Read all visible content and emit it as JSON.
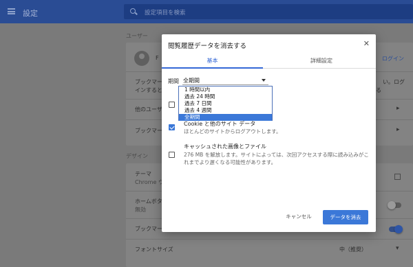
{
  "header": {
    "title": "設定",
    "search_placeholder": "設定項目を検索"
  },
  "background": {
    "section_user": "ユーザー",
    "user_name_partial": "F",
    "signin_link": "ログイン",
    "bookmark_row_a": "ブックマー",
    "sync_text_right": "い。ログ",
    "sync_text_line2": "インすると",
    "sync_text_line2_right": "る",
    "other_people": "他のユーザ",
    "bookmark_row_b": "ブックマー",
    "section_design": "デザイン",
    "theme_label": "テーマ",
    "theme_value": "Chrome ウ",
    "home_label": "ホームボタ",
    "home_value": "無効",
    "bookmark_bar": "ブックマー",
    "font_size_label": "フォントサイズ",
    "font_size_value": "中（推奨）",
    "colors": {
      "header": "#2a4c94",
      "page_dimmed": "#7a7a7a",
      "card_dimmed": "#838383"
    }
  },
  "dialog": {
    "title": "閲覧履歴データを消去する",
    "close_icon": "close-icon",
    "tabs": [
      {
        "label": "基本"
      },
      {
        "label": "詳細設定"
      }
    ],
    "time_range": {
      "label": "期間",
      "value": "全期間",
      "options": [
        {
          "label": "1 時間以内"
        },
        {
          "label": "過去 24 時間"
        },
        {
          "label": "過去 7 日間"
        },
        {
          "label": "過去 4 週間"
        },
        {
          "label": "全期間"
        }
      ]
    },
    "items": [
      {
        "title": "",
        "description": "リート データを削除します。",
        "checked": false
      },
      {
        "title": "Cookie と他のサイト データ",
        "description": "ほとんどのサイトからログアウトします。",
        "checked": true
      },
      {
        "title": "キャッシュされた画像とファイル",
        "description": "276 MB を解放します。サイトによっては、次回アクセスする際に読み込みがこれまでより遅くなる可能性があります。",
        "checked": false
      }
    ],
    "cancel_label": "キャンセル",
    "clear_label": "データを消去",
    "accent": "#3b78d8"
  }
}
